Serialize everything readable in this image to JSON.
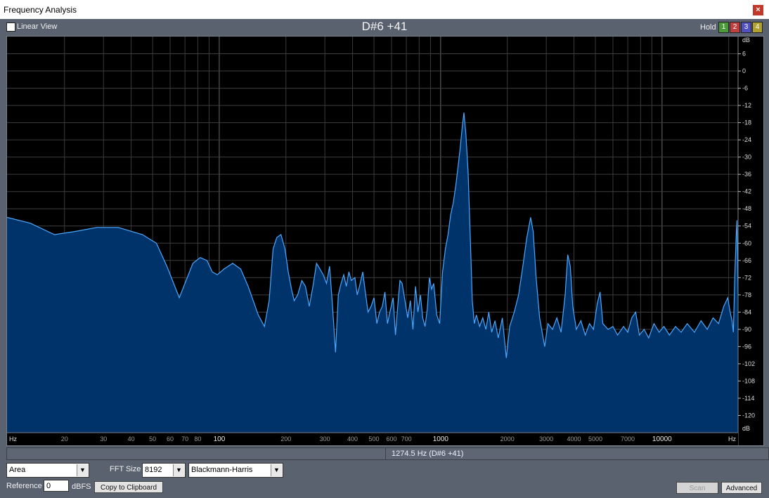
{
  "window": {
    "title": "Frequency Analysis",
    "close_glyph": "×"
  },
  "top": {
    "linear_view_label": "Linear View",
    "linear_view_checked": false,
    "note": "D#6 +41",
    "hold_label": "Hold",
    "hold_buttons": [
      {
        "label": "1",
        "color": "#4a9a3a"
      },
      {
        "label": "2",
        "color": "#c04040"
      },
      {
        "label": "3",
        "color": "#5050c0"
      },
      {
        "label": "4",
        "color": "#b0a030"
      }
    ]
  },
  "chart_data": {
    "type": "area",
    "x_scale": "log",
    "xlabel": "Hz",
    "ylabel": "dB",
    "xlim": [
      11,
      22050
    ],
    "ylim": [
      -126,
      12
    ],
    "x_tick_labels": [
      {
        "v": 20,
        "label": "20"
      },
      {
        "v": 30,
        "label": "30"
      },
      {
        "v": 40,
        "label": "40"
      },
      {
        "v": 50,
        "label": "50"
      },
      {
        "v": 60,
        "label": "60"
      },
      {
        "v": 70,
        "label": "70"
      },
      {
        "v": 80,
        "label": "80"
      },
      {
        "v": 100,
        "label": "100"
      },
      {
        "v": 200,
        "label": "200"
      },
      {
        "v": 300,
        "label": "300"
      },
      {
        "v": 400,
        "label": "400"
      },
      {
        "v": 500,
        "label": "500"
      },
      {
        "v": 600,
        "label": "600"
      },
      {
        "v": 700,
        "label": "700"
      },
      {
        "v": 1000,
        "label": "1000"
      },
      {
        "v": 2000,
        "label": "2000"
      },
      {
        "v": 3000,
        "label": "3000"
      },
      {
        "v": 4000,
        "label": "4000"
      },
      {
        "v": 5000,
        "label": "5000"
      },
      {
        "v": 7000,
        "label": "7000"
      },
      {
        "v": 10000,
        "label": "10000"
      }
    ],
    "y_ticks": [
      6,
      0,
      -6,
      -12,
      -18,
      -24,
      -30,
      -36,
      -42,
      -48,
      -54,
      -60,
      -66,
      -72,
      -78,
      -84,
      -90,
      -96,
      -102,
      -108,
      -114,
      -120
    ],
    "grid": true,
    "fill_color": "#003369",
    "line_color": "#4aa8ff",
    "series": [
      {
        "points": [
          [
            11,
            -51
          ],
          [
            14,
            -53
          ],
          [
            18,
            -57
          ],
          [
            22,
            -56
          ],
          [
            28,
            -54.5
          ],
          [
            35,
            -54.5
          ],
          [
            45,
            -57
          ],
          [
            52,
            -60
          ],
          [
            58,
            -68
          ],
          [
            63,
            -75
          ],
          [
            66,
            -79
          ],
          [
            70,
            -74
          ],
          [
            76,
            -67
          ],
          [
            82,
            -65
          ],
          [
            88,
            -66
          ],
          [
            93,
            -70
          ],
          [
            98,
            -71
          ],
          [
            105,
            -69
          ],
          [
            115,
            -67
          ],
          [
            125,
            -69
          ],
          [
            135,
            -75
          ],
          [
            150,
            -85
          ],
          [
            160,
            -89
          ],
          [
            168,
            -80
          ],
          [
            175,
            -62
          ],
          [
            182,
            -58
          ],
          [
            190,
            -57
          ],
          [
            198,
            -62
          ],
          [
            205,
            -70
          ],
          [
            212,
            -76
          ],
          [
            218,
            -80
          ],
          [
            226,
            -78
          ],
          [
            236,
            -73
          ],
          [
            245,
            -75
          ],
          [
            255,
            -82
          ],
          [
            265,
            -75
          ],
          [
            275,
            -67
          ],
          [
            285,
            -69
          ],
          [
            295,
            -71
          ],
          [
            305,
            -74
          ],
          [
            315,
            -68
          ],
          [
            325,
            -82
          ],
          [
            335,
            -98
          ],
          [
            345,
            -78
          ],
          [
            355,
            -74
          ],
          [
            365,
            -71
          ],
          [
            375,
            -75
          ],
          [
            385,
            -70
          ],
          [
            395,
            -73
          ],
          [
            410,
            -72
          ],
          [
            420,
            -78
          ],
          [
            430,
            -75
          ],
          [
            445,
            -70
          ],
          [
            455,
            -76
          ],
          [
            470,
            -84
          ],
          [
            485,
            -82
          ],
          [
            500,
            -79
          ],
          [
            515,
            -88
          ],
          [
            530,
            -84
          ],
          [
            545,
            -82
          ],
          [
            560,
            -77
          ],
          [
            575,
            -88
          ],
          [
            590,
            -84
          ],
          [
            610,
            -79
          ],
          [
            625,
            -92
          ],
          [
            640,
            -82
          ],
          [
            655,
            -73
          ],
          [
            670,
            -74
          ],
          [
            690,
            -80
          ],
          [
            710,
            -86
          ],
          [
            730,
            -80
          ],
          [
            750,
            -90
          ],
          [
            770,
            -75
          ],
          [
            790,
            -84
          ],
          [
            810,
            -78
          ],
          [
            830,
            -86
          ],
          [
            850,
            -89
          ],
          [
            870,
            -83
          ],
          [
            890,
            -72
          ],
          [
            910,
            -76
          ],
          [
            930,
            -74
          ],
          [
            960,
            -85
          ],
          [
            990,
            -88
          ],
          [
            1020,
            -70
          ],
          [
            1050,
            -62
          ],
          [
            1080,
            -57
          ],
          [
            1110,
            -50
          ],
          [
            1140,
            -46
          ],
          [
            1170,
            -40
          ],
          [
            1200,
            -33
          ],
          [
            1225,
            -27
          ],
          [
            1250,
            -20
          ],
          [
            1274,
            -14.5
          ],
          [
            1300,
            -22
          ],
          [
            1330,
            -35
          ],
          [
            1360,
            -57
          ],
          [
            1390,
            -80
          ],
          [
            1420,
            -88
          ],
          [
            1450,
            -85
          ],
          [
            1500,
            -89
          ],
          [
            1550,
            -86
          ],
          [
            1600,
            -90
          ],
          [
            1650,
            -84
          ],
          [
            1700,
            -91
          ],
          [
            1760,
            -87
          ],
          [
            1820,
            -93
          ],
          [
            1900,
            -86
          ],
          [
            1980,
            -100
          ],
          [
            2050,
            -89
          ],
          [
            2150,
            -84
          ],
          [
            2250,
            -78
          ],
          [
            2350,
            -68
          ],
          [
            2450,
            -58
          ],
          [
            2550,
            -51
          ],
          [
            2620,
            -56
          ],
          [
            2700,
            -72
          ],
          [
            2800,
            -86
          ],
          [
            2950,
            -96
          ],
          [
            3050,
            -88
          ],
          [
            3200,
            -90
          ],
          [
            3350,
            -86
          ],
          [
            3500,
            -91
          ],
          [
            3650,
            -78
          ],
          [
            3750,
            -64
          ],
          [
            3850,
            -68
          ],
          [
            3950,
            -82
          ],
          [
            4100,
            -90
          ],
          [
            4300,
            -87
          ],
          [
            4500,
            -92
          ],
          [
            4700,
            -88
          ],
          [
            4900,
            -90
          ],
          [
            5100,
            -81
          ],
          [
            5250,
            -77
          ],
          [
            5400,
            -88
          ],
          [
            5700,
            -90
          ],
          [
            6000,
            -89
          ],
          [
            6300,
            -92
          ],
          [
            6700,
            -89
          ],
          [
            7000,
            -91
          ],
          [
            7300,
            -86
          ],
          [
            7600,
            -84
          ],
          [
            7900,
            -92
          ],
          [
            8300,
            -90
          ],
          [
            8700,
            -93
          ],
          [
            9200,
            -88
          ],
          [
            9700,
            -91
          ],
          [
            10200,
            -89
          ],
          [
            10800,
            -92
          ],
          [
            11500,
            -89
          ],
          [
            12200,
            -91
          ],
          [
            13000,
            -88
          ],
          [
            14000,
            -91
          ],
          [
            15000,
            -87
          ],
          [
            16000,
            -90
          ],
          [
            17000,
            -86
          ],
          [
            18000,
            -88
          ],
          [
            19000,
            -82
          ],
          [
            19800,
            -79
          ],
          [
            20300,
            -84
          ],
          [
            20700,
            -87
          ],
          [
            21000,
            -91
          ],
          [
            21300,
            -72
          ],
          [
            21600,
            -58
          ],
          [
            21800,
            -52
          ],
          [
            22050,
            -78
          ]
        ]
      }
    ]
  },
  "plot_labels": {
    "x_left": "Hz",
    "x_right": "Hz",
    "y_top": "dB",
    "y_bottom": "dB"
  },
  "readout": {
    "left": "",
    "right": "1274.5 Hz (D#6 +41)"
  },
  "controls": {
    "display_mode": "Area",
    "fft_label": "FFT Size",
    "fft_size": "8192",
    "window_fn": "Blackmann-Harris",
    "reference_label": "Reference",
    "reference_value": "0",
    "reference_unit": "dBFS",
    "copy_button": "Copy to Clipboard",
    "scan_button": "Scan",
    "advanced_button": "Advanced",
    "dropdown_glyph": "▼"
  }
}
